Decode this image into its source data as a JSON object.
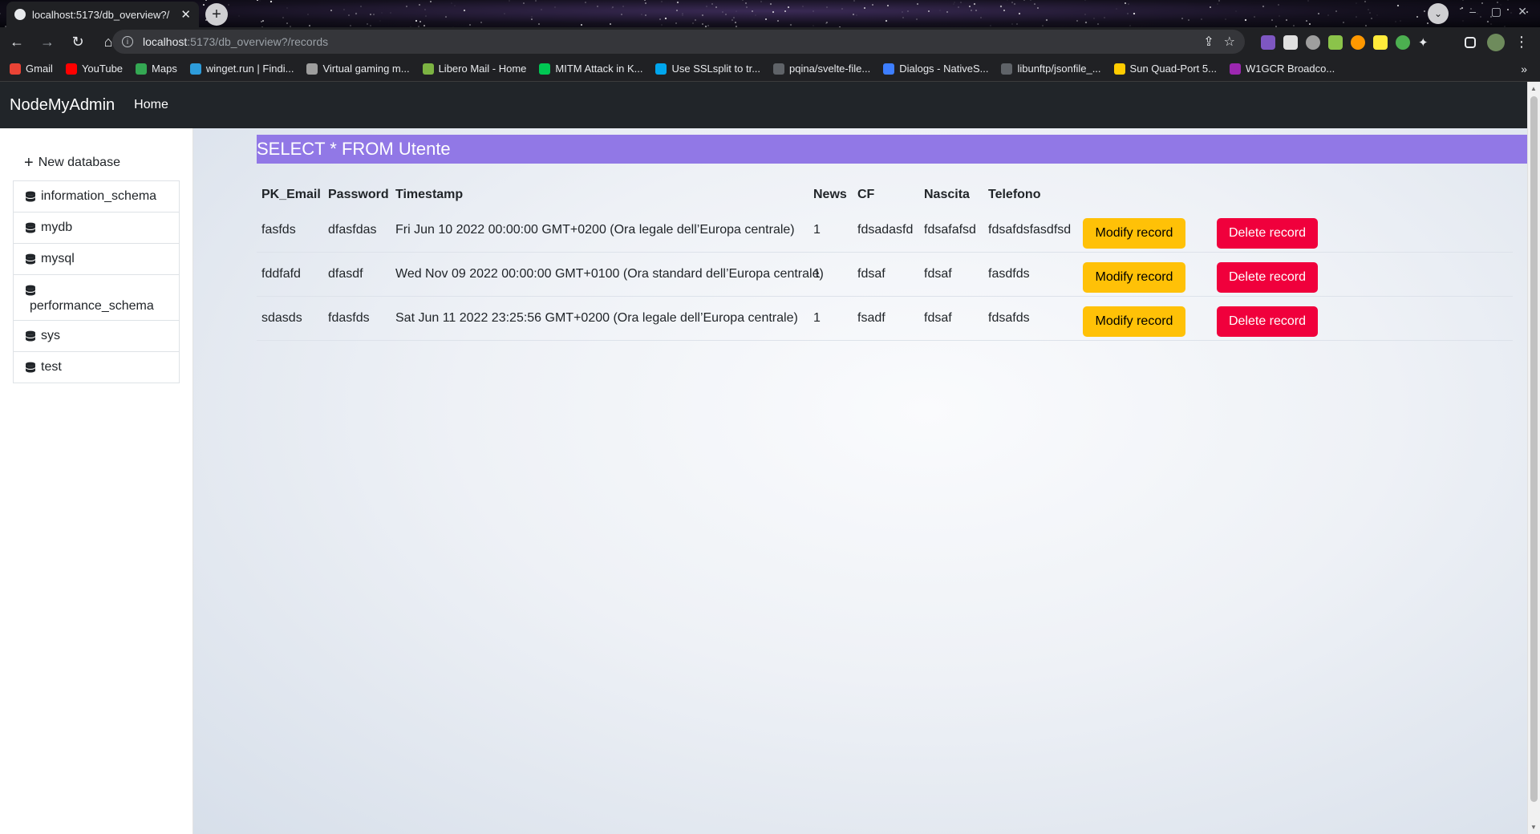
{
  "browser": {
    "tab_title": "localhost:5173/db_overview?/",
    "new_tab_icon": "+",
    "address_host": "localhost",
    "address_path": ":5173/db_overview?/records",
    "bookmarks": [
      {
        "label": "Gmail",
        "color": "#ea4335"
      },
      {
        "label": "YouTube",
        "color": "#ff0000"
      },
      {
        "label": "Maps",
        "color": "#34a853"
      },
      {
        "label": "winget.run | Findi...",
        "color": "#2d9cdb"
      },
      {
        "label": "Virtual gaming m...",
        "color": "#9e9e9e"
      },
      {
        "label": "Libero Mail - Home",
        "color": "#7cb342"
      },
      {
        "label": "MITM Attack in K...",
        "color": "#00c853"
      },
      {
        "label": "Use SSLsplit to tr...",
        "color": "#00a6ed"
      },
      {
        "label": "pqina/svelte-file...",
        "color": "#5f6368"
      },
      {
        "label": "Dialogs - NativeS...",
        "color": "#3d7eff"
      },
      {
        "label": "libunftp/jsonfile_...",
        "color": "#5f6368"
      },
      {
        "label": "Sun Quad-Port 5...",
        "color": "#ffcc00"
      },
      {
        "label": "W1GCR Broadco...",
        "color": "#9c27b0"
      }
    ],
    "bookmarks_more": "»"
  },
  "app": {
    "brand": "NodeMyAdmin",
    "nav_home": "Home"
  },
  "sidebar": {
    "new_database": "New database",
    "databases": [
      "information_schema",
      "mydb",
      "mysql",
      "performance_schema",
      "sys",
      "test"
    ]
  },
  "query": {
    "text": "SELECT * FROM Utente"
  },
  "table": {
    "columns": [
      "PK_Email",
      "Password",
      "Timestamp",
      "News",
      "CF",
      "Nascita",
      "Telefono"
    ],
    "rows": [
      [
        "fasfds",
        "dfasfdas",
        "Fri Jun 10 2022 00:00:00 GMT+0200 (Ora legale dell’Europa centrale)",
        "1",
        "fdsadasfd",
        "fdsafafsd",
        "fdsafdsfasdfsd"
      ],
      [
        "fddfafd",
        "dfasdf",
        "Wed Nov 09 2022 00:00:00 GMT+0100 (Ora standard dell’Europa centrale)",
        "1",
        "fdsaf",
        "fdsaf",
        "fasdfds"
      ],
      [
        "sdasds",
        "fdasfds",
        "Sat Jun 11 2022 23:25:56 GMT+0200 (Ora legale dell’Europa centrale)",
        "1",
        "fsadf",
        "fdsaf",
        "fdsafds"
      ]
    ],
    "modify_label": "Modify record",
    "delete_label": "Delete record"
  },
  "colors": {
    "query_bar": "#9178e6",
    "modify_button": "#ffc107",
    "delete_button": "#f0003c",
    "navbar": "#212529"
  }
}
